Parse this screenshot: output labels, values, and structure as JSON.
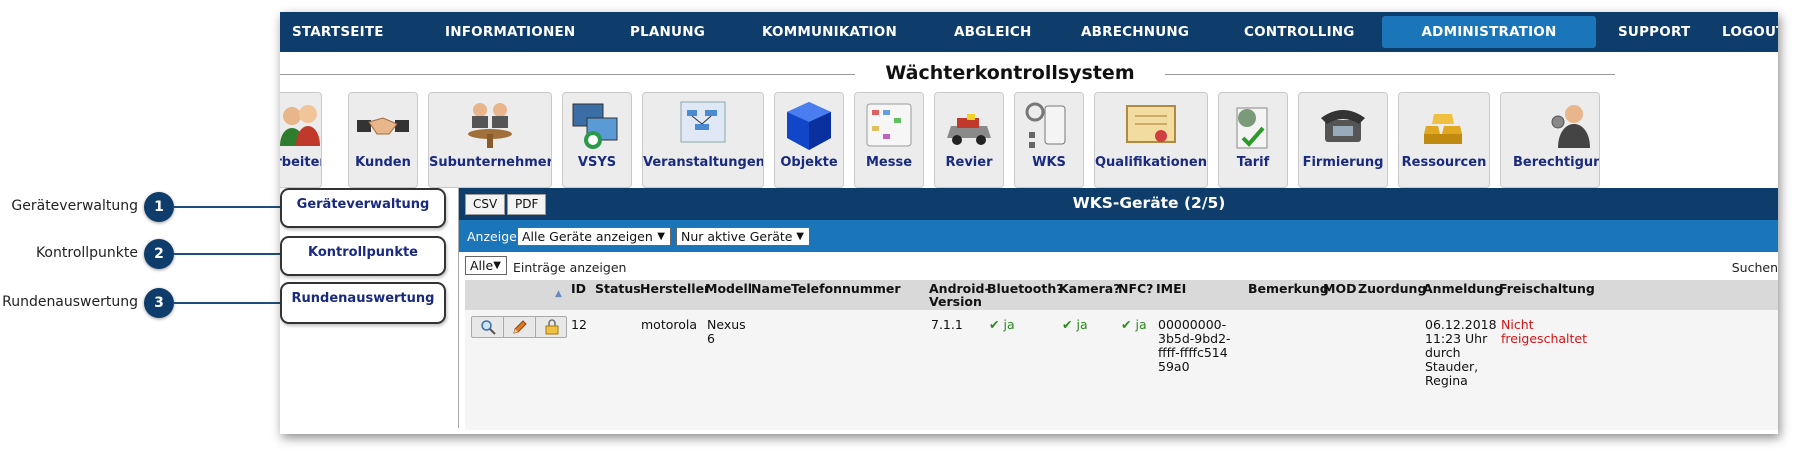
{
  "callouts": [
    {
      "label": "Geräteverwaltung",
      "number": "1"
    },
    {
      "label": "Kontrollpunkte",
      "number": "2"
    },
    {
      "label": "Rundenauswertung",
      "number": "3"
    }
  ],
  "nav": {
    "items": [
      "STARTSEITE",
      "INFORMATIONEN",
      "PLANUNG",
      "KOMMUNIKATION",
      "ABGLEICH",
      "ABRECHNUNG",
      "CONTROLLING",
      "ADMINISTRATION",
      "SUPPORT",
      "LOGOUT"
    ],
    "active": "ADMINISTRATION"
  },
  "system_title": "Wächterkontrollsystem",
  "tiles": [
    {
      "label": "Mitarbeiter",
      "icon": "employees-icon"
    },
    {
      "label": "Kunden",
      "icon": "handshake-icon"
    },
    {
      "label": "Subunternehmer",
      "icon": "subcontractor-icon"
    },
    {
      "label": "VSYS",
      "icon": "vsys-computers-icon"
    },
    {
      "label": "Veranstaltungen",
      "icon": "events-chart-icon"
    },
    {
      "label": "Objekte",
      "icon": "cube-icon"
    },
    {
      "label": "Messe",
      "icon": "calendar-icon"
    },
    {
      "label": "Revier",
      "icon": "patrol-car-icon"
    },
    {
      "label": "WKS",
      "icon": "wks-device-icon"
    },
    {
      "label": "Qualifikationen",
      "icon": "certificate-icon"
    },
    {
      "label": "Tarif",
      "icon": "tariff-icon"
    },
    {
      "label": "Firmierung",
      "icon": "phone-icon"
    },
    {
      "label": "Ressourcen",
      "icon": "gold-bars-icon"
    },
    {
      "label": "Berechtigungen",
      "icon": "user-permissions-icon"
    }
  ],
  "sidebar": {
    "items": [
      "Geräteverwaltung",
      "Kontrollpunkte",
      "Rundenauswertung"
    ]
  },
  "panel": {
    "csv_label": "CSV",
    "pdf_label": "PDF",
    "title": "WKS-Geräte (2/5)",
    "filter_label": "Anzeige:",
    "filter_devices": "Alle Geräte anzeigen",
    "filter_active": "Nur aktive Geräte",
    "length_value": "Alle",
    "length_label": "Einträge anzeigen",
    "search_label": "Suchen"
  },
  "table": {
    "columns": [
      "ID",
      "Status",
      "Hersteller",
      "Modell",
      "Name",
      "Telefonnummer",
      "Android-Version",
      "Bluetooth?",
      "Kamera?",
      "NFC?",
      "IMEI",
      "Bemerkung",
      "MOD",
      "Zuordung",
      "Anmeldung",
      "Freischaltung"
    ],
    "rows": [
      {
        "id": "12",
        "status": "",
        "hersteller": "motorola",
        "modell": "Nexus 6",
        "name": "",
        "telefonnummer": "",
        "android": "7.1.1",
        "bluetooth": "ja",
        "kamera": "ja",
        "nfc": "ja",
        "imei": "00000000-3b5d-9bd2-ffff-ffffc51459a0",
        "bemerkung": "",
        "mod": "",
        "zuordung": "",
        "anmeldung": "06.12.2018 11:23 Uhr durch Stauder, Regina",
        "freischaltung": "Nicht freigeschaltet"
      }
    ]
  },
  "colors": {
    "nav_bg": "#0f3d6b",
    "nav_active": "#1a76b8",
    "filter_bg": "#1a76b8",
    "check_green": "#2a8a1a",
    "alert_red": "#d01515",
    "search_highlight": "#ffff00"
  }
}
